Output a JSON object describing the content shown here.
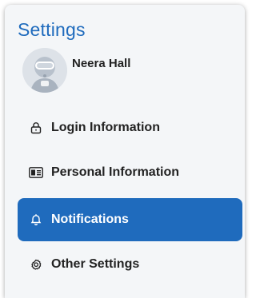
{
  "settings": {
    "title": "Settings",
    "user_name": "Neera Hall",
    "menu": [
      {
        "label": "Login Information",
        "icon": "lock-icon"
      },
      {
        "label": "Personal Information",
        "icon": "id-card-icon"
      },
      {
        "label": "Notifications",
        "icon": "bell-icon",
        "active": true
      },
      {
        "label": "Other Settings",
        "icon": "gear-icon"
      }
    ]
  },
  "colors": {
    "accent": "#1f6bbd",
    "title": "#1f6bbd",
    "panel_bg": "#f4f6f8"
  }
}
